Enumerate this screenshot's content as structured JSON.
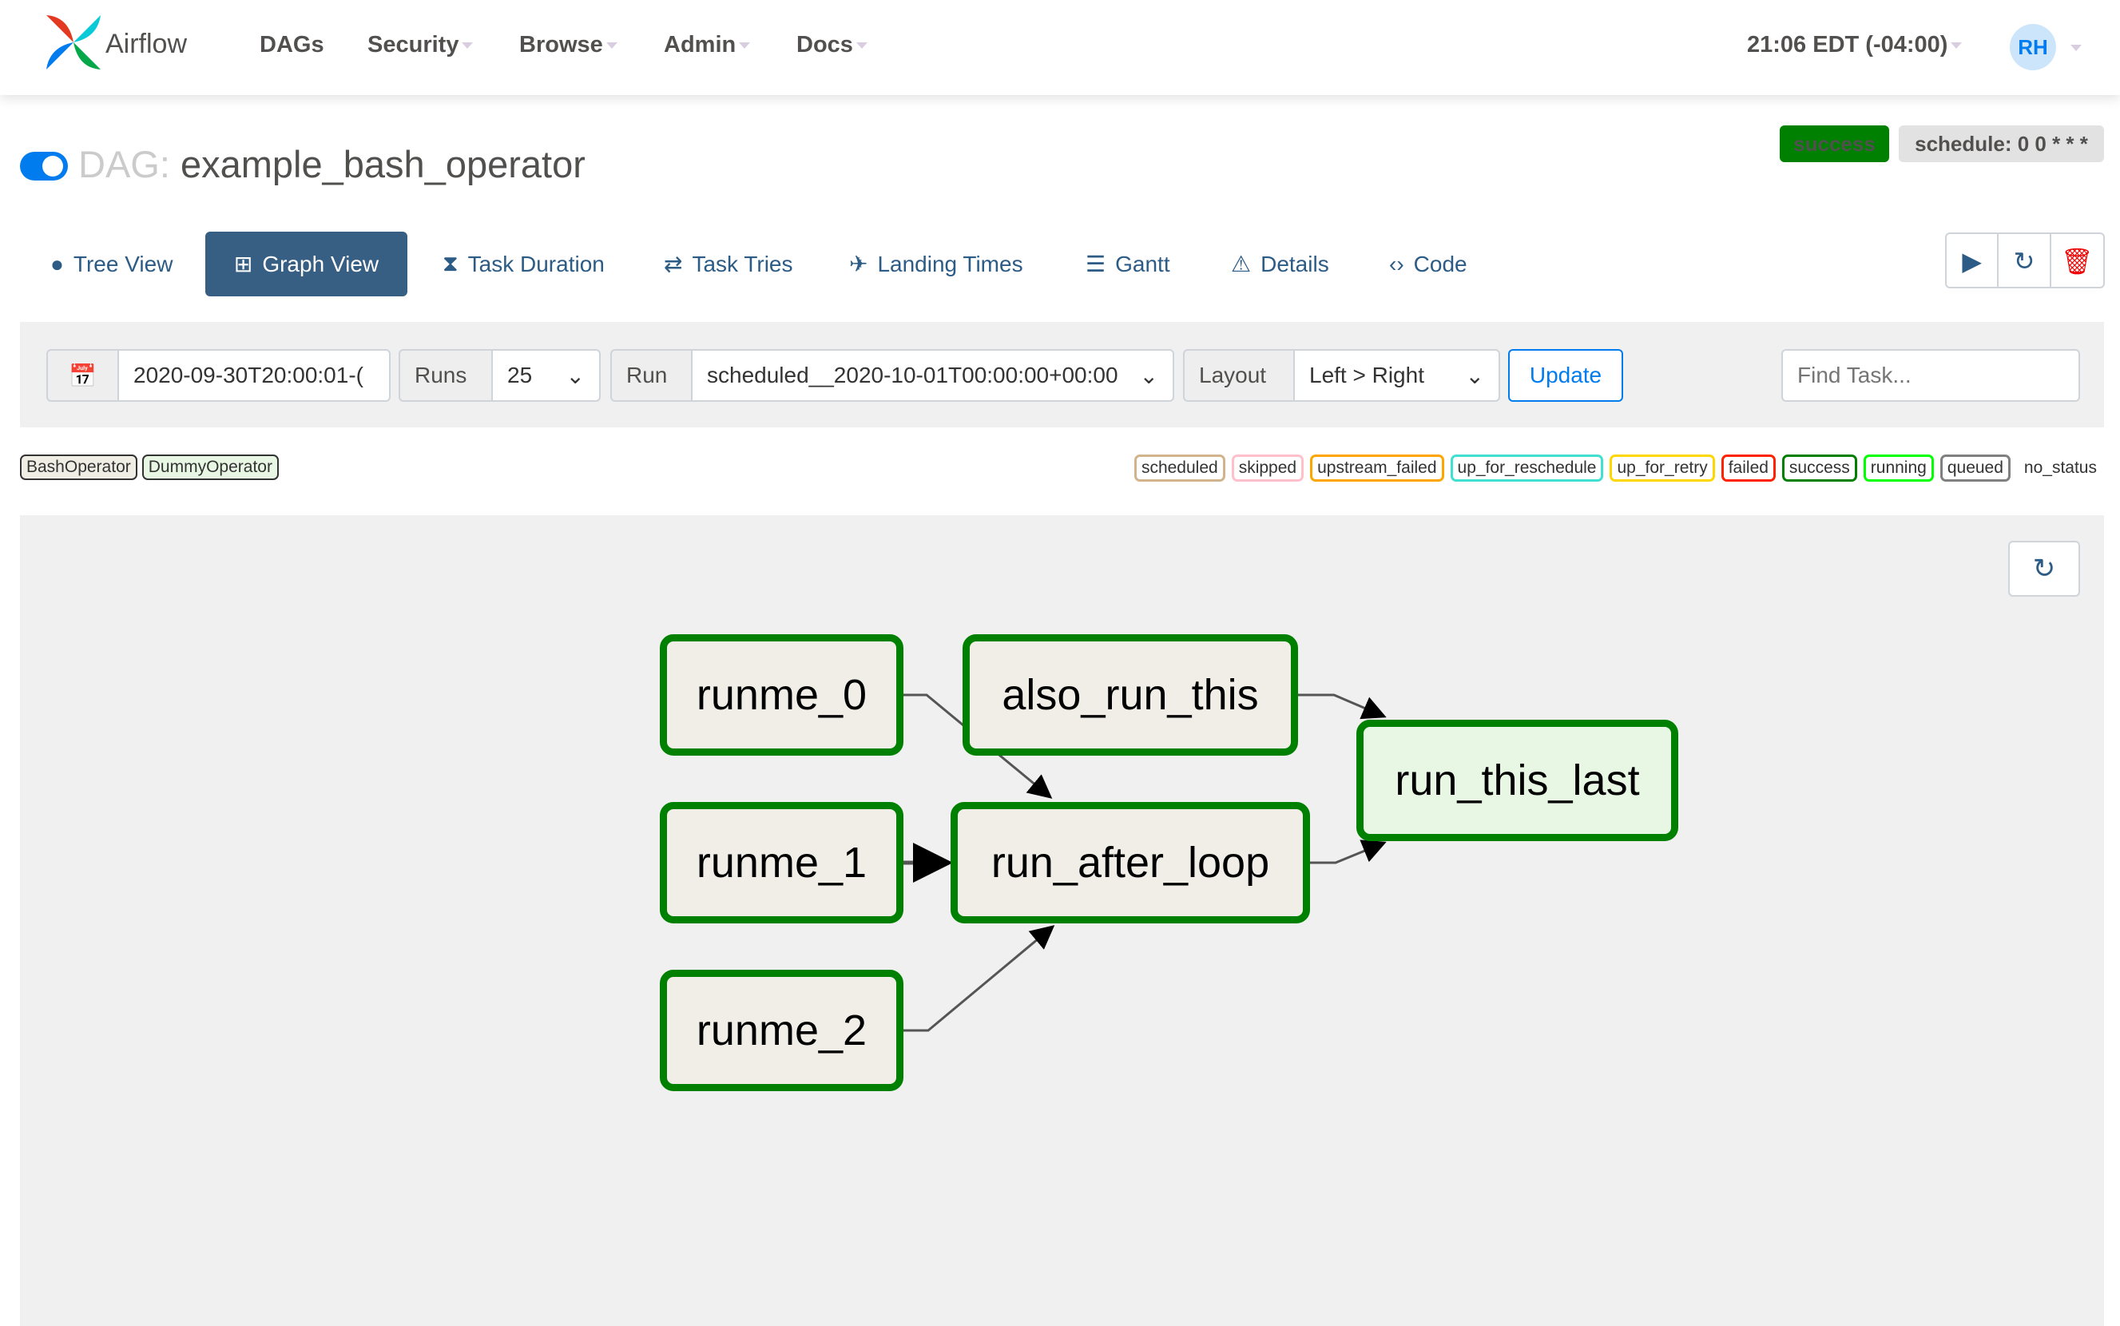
{
  "navbar": {
    "brand": "Airflow",
    "items": [
      {
        "label": "DAGs",
        "dropdown": false
      },
      {
        "label": "Security",
        "dropdown": true
      },
      {
        "label": "Browse",
        "dropdown": true
      },
      {
        "label": "Admin",
        "dropdown": true
      },
      {
        "label": "Docs",
        "dropdown": true
      }
    ],
    "time": "21:06 EDT (-04:00)",
    "avatar": "RH"
  },
  "dag": {
    "prefix": "DAG:",
    "name": "example_bash_operator",
    "paused": false,
    "state": "success",
    "state_color": "#008000",
    "schedule": "schedule: 0 0 * * *"
  },
  "tabs": [
    {
      "label": "Tree View",
      "icon": "tree-icon"
    },
    {
      "label": "Graph View",
      "icon": "graph-icon",
      "active": true
    },
    {
      "label": "Task Duration",
      "icon": "hourglass-icon"
    },
    {
      "label": "Task Tries",
      "icon": "retweet-icon"
    },
    {
      "label": "Landing Times",
      "icon": "plane-arrival-icon"
    },
    {
      "label": "Gantt",
      "icon": "gantt-icon"
    },
    {
      "label": "Details",
      "icon": "warning-triangle-icon"
    },
    {
      "label": "Code",
      "icon": "code-icon"
    }
  ],
  "filters": {
    "execution_date": "2020-09-30T20:00:01-(",
    "runs_label": "Runs",
    "runs_value": "25",
    "run_label": "Run",
    "run_value": "scheduled__2020-10-01T00:00:00+00:00",
    "layout_label": "Layout",
    "layout_value": "Left > Right",
    "update": "Update",
    "find_placeholder": "Find Task..."
  },
  "operators": [
    {
      "label": "BashOperator",
      "color": "#f0ede4"
    },
    {
      "label": "DummyOperator",
      "color": "#e8f7e4"
    }
  ],
  "states": [
    {
      "label": "scheduled",
      "color": "#d2b48c"
    },
    {
      "label": "skipped",
      "color": "#ffc0cb"
    },
    {
      "label": "upstream_failed",
      "color": "#ffa500"
    },
    {
      "label": "up_for_reschedule",
      "color": "#40e0d0"
    },
    {
      "label": "up_for_retry",
      "color": "#ffd700"
    },
    {
      "label": "failed",
      "color": "#ff2200"
    },
    {
      "label": "success",
      "color": "#008000"
    },
    {
      "label": "running",
      "color": "#00ff00"
    },
    {
      "label": "queued",
      "color": "#808080"
    },
    {
      "label": "no_status",
      "color": ""
    }
  ],
  "graph": {
    "nodes": [
      {
        "id": "runme_0",
        "label": "runme_0"
      },
      {
        "id": "also_run_this",
        "label": "also_run_this"
      },
      {
        "id": "runme_1",
        "label": "runme_1"
      },
      {
        "id": "run_after_loop",
        "label": "run_after_loop"
      },
      {
        "id": "runme_2",
        "label": "runme_2"
      },
      {
        "id": "run_this_last",
        "label": "run_this_last"
      }
    ],
    "edges": [
      [
        "runme_0",
        "run_after_loop"
      ],
      [
        "runme_1",
        "run_after_loop"
      ],
      [
        "runme_2",
        "run_after_loop"
      ],
      [
        "also_run_this",
        "run_this_last"
      ],
      [
        "run_after_loop",
        "run_this_last"
      ]
    ]
  }
}
